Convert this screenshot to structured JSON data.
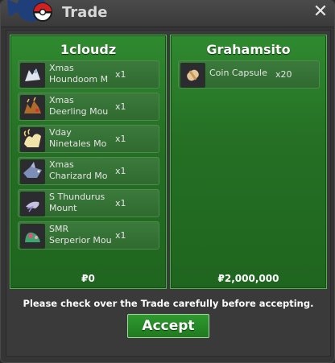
{
  "window": {
    "title": "Trade",
    "close_icon": "close-icon"
  },
  "left": {
    "name": "1cloudz",
    "money": "₽0",
    "items": [
      {
        "name": "Xmas\nHoundoom M",
        "qty": "x1",
        "icon": "houndoom-mount-icon"
      },
      {
        "name": "Xmas\nDeerling Mou",
        "qty": "x1",
        "icon": "deerling-mount-icon"
      },
      {
        "name": "Vday\nNinetales Mo",
        "qty": "x1",
        "icon": "ninetales-mount-icon"
      },
      {
        "name": "Xmas\nCharizard Mo",
        "qty": "x1",
        "icon": "charizard-mount-icon"
      },
      {
        "name": "S Thundurus\nMount",
        "qty": "x1",
        "icon": "thundurus-mount-icon"
      },
      {
        "name": "SMR\nSerperior Mou",
        "qty": "x1",
        "icon": "serperior-mount-icon"
      }
    ]
  },
  "right": {
    "name": "Grahamsito",
    "money": "₽2,000,000",
    "items": [
      {
        "name": "Coin Capsule",
        "qty": "x20",
        "icon": "coin-capsule-icon"
      }
    ]
  },
  "notice": "Please check over the Trade carefully before accepting.",
  "accept_label": "Accept",
  "colors": {
    "panel_green": "#257025",
    "accept_green": "#1f7a1f"
  }
}
